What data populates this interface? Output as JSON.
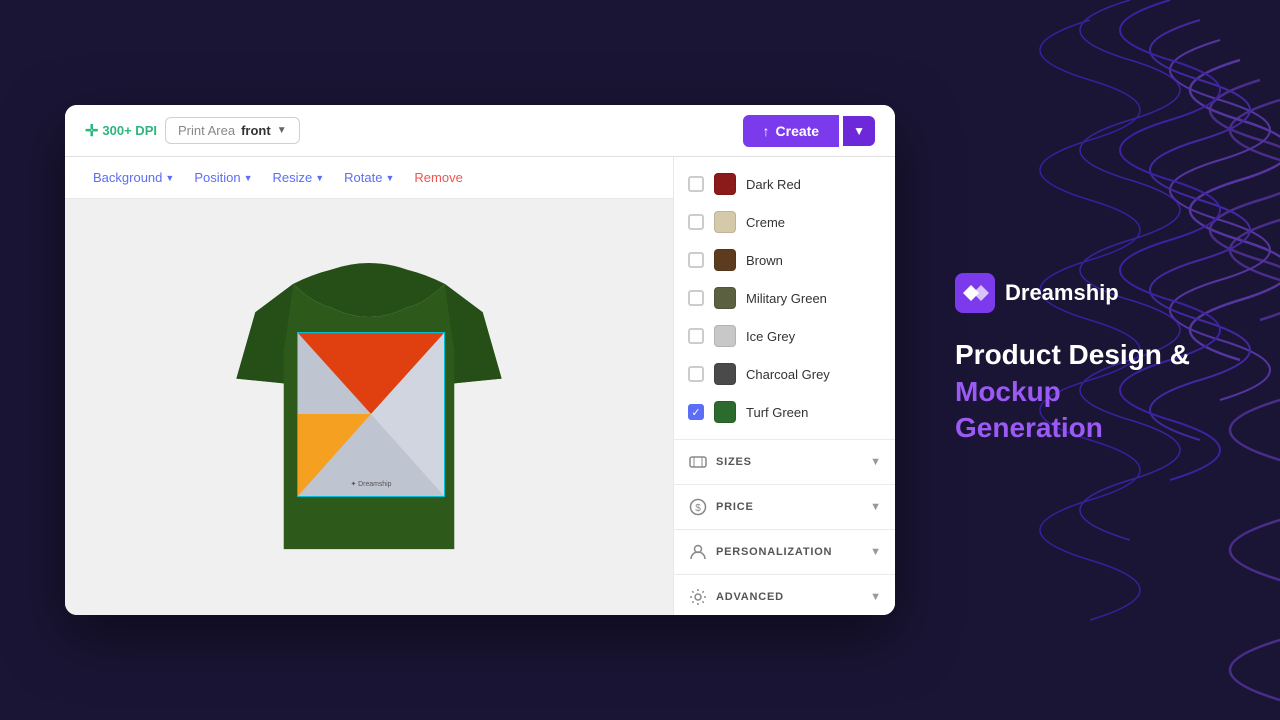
{
  "background": {
    "primary_color": "#1a1535",
    "wave_color": "#3a2a6e"
  },
  "toolbar": {
    "dpi_label": "300+ DPI",
    "print_area_label": "Print Area",
    "print_area_value": "front",
    "create_label": "Create"
  },
  "canvas_toolbar": {
    "background_label": "Background",
    "position_label": "Position",
    "resize_label": "Resize",
    "rotate_label": "Rotate",
    "remove_label": "Remove"
  },
  "colors": [
    {
      "name": "Dark Red",
      "swatch": "#8b1a1a",
      "checked": false
    },
    {
      "name": "Creme",
      "swatch": "#d4c9a8",
      "checked": false
    },
    {
      "name": "Brown",
      "swatch": "#5c3b1e",
      "checked": false
    },
    {
      "name": "Military Green",
      "swatch": "#5a6040",
      "checked": false
    },
    {
      "name": "Ice Grey",
      "swatch": "#c8c8c8",
      "checked": false
    },
    {
      "name": "Charcoal Grey",
      "swatch": "#4a4a4a",
      "checked": false
    },
    {
      "name": "Turf Green",
      "swatch": "#2d6a2d",
      "checked": true
    }
  ],
  "sections": [
    {
      "label": "SIZES",
      "icon": "⊞"
    },
    {
      "label": "PRICE",
      "icon": "$"
    },
    {
      "label": "PERSONALIZATION",
      "icon": "👤"
    },
    {
      "label": "ADVANCED",
      "icon": "⚙"
    }
  ],
  "branding": {
    "logo_text": "Dreamship",
    "tagline_line1": "Product Design &",
    "tagline_line2": "Mockup Generation"
  }
}
